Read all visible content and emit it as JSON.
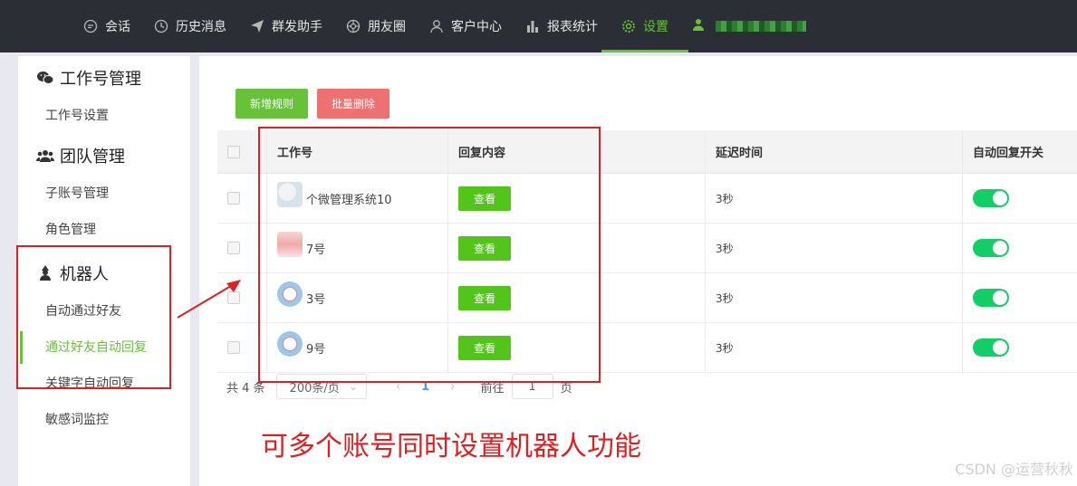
{
  "topnav": {
    "items": [
      {
        "label": "会话",
        "icon": "chat-icon"
      },
      {
        "label": "历史消息",
        "icon": "clock-icon"
      },
      {
        "label": "群发助手",
        "icon": "send-icon"
      },
      {
        "label": "朋友圈",
        "icon": "moments-icon"
      },
      {
        "label": "客户中心",
        "icon": "user-icon"
      },
      {
        "label": "报表统计",
        "icon": "bar-chart-icon"
      },
      {
        "label": "设置",
        "icon": "gear-icon",
        "active": true
      }
    ],
    "accent": "#67c23a"
  },
  "sidebar": {
    "groups": [
      {
        "title": "工作号管理",
        "icon": "wechat-icon",
        "items": [
          "工作号设置"
        ]
      },
      {
        "title": "团队管理",
        "icon": "team-icon",
        "items": [
          "子账号管理",
          "角色管理"
        ]
      },
      {
        "title": "机器人",
        "icon": "robot-icon",
        "items": [
          "自动通过好友",
          "通过好友自动回复",
          "关键字自动回复",
          "敏感词监控"
        ]
      }
    ],
    "active_item": "通过好友自动回复"
  },
  "toolbar": {
    "add_label": "新增规则",
    "delete_label": "批量删除"
  },
  "table": {
    "headers": [
      "工作号",
      "回复内容",
      "延迟时间",
      "自动回复开关"
    ],
    "rows": [
      {
        "account": "个微管理系统10",
        "reply": "查看",
        "delay": "3秒",
        "switch_on": true
      },
      {
        "account": "7号",
        "reply": "查看",
        "delay": "3秒",
        "switch_on": true
      },
      {
        "account": "3号",
        "reply": "查看",
        "delay": "3秒",
        "switch_on": true
      },
      {
        "account": "9号",
        "reply": "查看",
        "delay": "3秒",
        "switch_on": true
      }
    ]
  },
  "pagination": {
    "total": "共 4 条",
    "page_size": "200条/页",
    "current_page": "1",
    "goto_label": "前往",
    "goto_value": "1",
    "page_suffix": "页"
  },
  "annotation": {
    "text": "可多个账号同时设置机器人功能",
    "color": "#e02020"
  },
  "watermark": "CSDN @运营秋秋"
}
